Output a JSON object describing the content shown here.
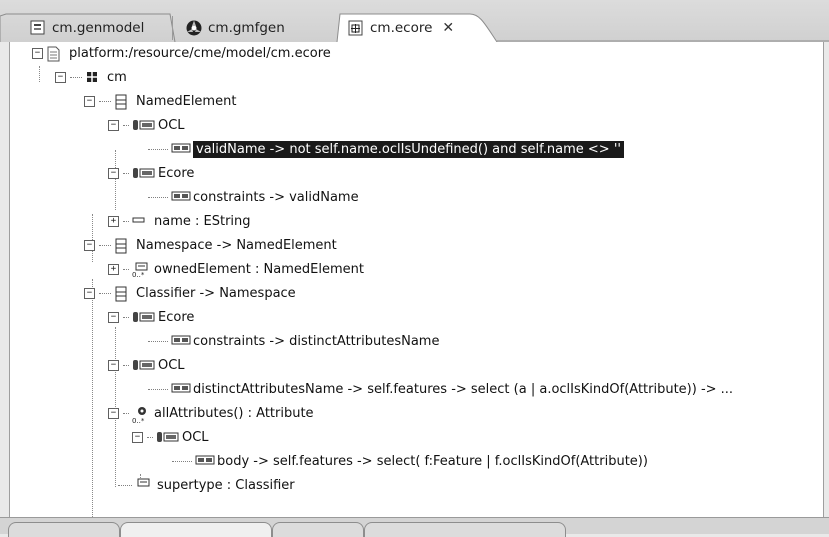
{
  "tabs": [
    {
      "label": "cm.genmodel",
      "icon": "genmodel-icon"
    },
    {
      "label": "cm.gmfgen",
      "icon": "gmfgen-icon"
    },
    {
      "label": "cm.ecore",
      "icon": "ecore-file-icon",
      "active": true,
      "close": "✕"
    }
  ],
  "tree": {
    "root": "platform:/resource/cme/model/cm.ecore",
    "package": "cm",
    "named_element": "NamedElement",
    "ocl_1": "OCL",
    "valid_name_expr": "validName -> not self.name.oclIsUndefined() and self.name <> ''",
    "ecore_1": "Ecore",
    "constraints_1": "constraints -> validName",
    "name_attr": "name : EString",
    "namespace": "Namespace -> NamedElement",
    "owned_element": "ownedElement : NamedElement",
    "classifier": "Classifier -> Namespace",
    "ecore_2": "Ecore",
    "constraints_2": "constraints -> distinctAttributesName",
    "ocl_2": "OCL",
    "distinct_expr": "distinctAttributesName -> self.features -> select (a | a.oclIsKindOf(Attribute)) -> ...",
    "all_attributes": "allAttributes() : Attribute",
    "ocl_3": "OCL",
    "body_expr": "body -> self.features -> select( f:Feature | f.oclIsKindOf(Attribute))",
    "supertype": "supertype : Classifier"
  }
}
